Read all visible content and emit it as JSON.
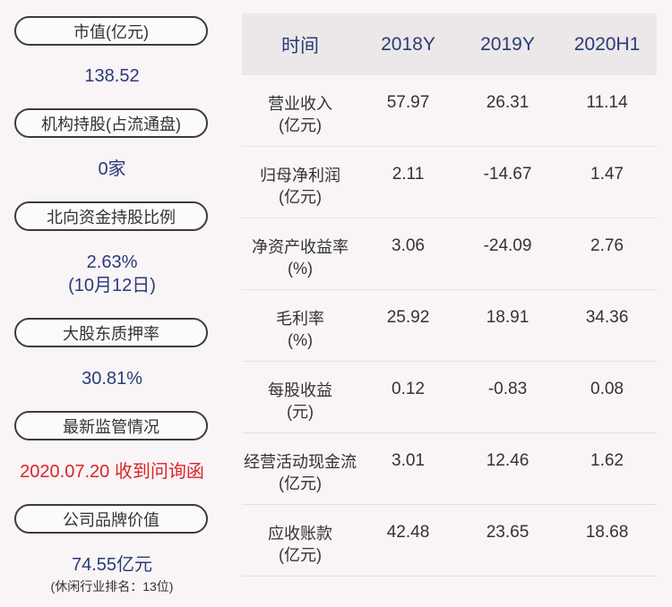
{
  "left": {
    "market_cap": {
      "label": "市值(亿元)",
      "value": "138.52"
    },
    "institution": {
      "label": "机构持股(占流通盘)",
      "value": "0家"
    },
    "northbound": {
      "label": "北向资金持股比例",
      "value": "2.63%",
      "date": "(10月12日)"
    },
    "pledge": {
      "label": "大股东质押率",
      "value": "30.81%"
    },
    "regulation": {
      "label": "最新监管情况",
      "value": "2020.07.20 收到问询函"
    },
    "brand": {
      "label": "公司品牌价值",
      "value": "74.55亿元",
      "rank": "(休闲行业排名：13位)"
    }
  },
  "table": {
    "headers": [
      "时间",
      "2018Y",
      "2019Y",
      "2020H1"
    ],
    "rows": [
      {
        "name": "营业收入",
        "unit": "(亿元)",
        "values": [
          "57.97",
          "26.31",
          "11.14"
        ]
      },
      {
        "name": "归母净利润",
        "unit": "(亿元)",
        "values": [
          "2.11",
          "-14.67",
          "1.47"
        ]
      },
      {
        "name": "净资产收益率",
        "unit": "(%)",
        "values": [
          "3.06",
          "-24.09",
          "2.76"
        ]
      },
      {
        "name": "毛利率",
        "unit": "(%)",
        "values": [
          "25.92",
          "18.91",
          "34.36"
        ]
      },
      {
        "name": "每股收益",
        "unit": "(元)",
        "values": [
          "0.12",
          "-0.83",
          "0.08"
        ]
      },
      {
        "name": "经营活动现金流",
        "unit": "(亿元)",
        "values": [
          "3.01",
          "12.46",
          "1.62"
        ]
      },
      {
        "name": "应收账款",
        "unit": "(亿元)",
        "values": [
          "42.48",
          "23.65",
          "18.68"
        ]
      }
    ]
  },
  "colors": {
    "accent": "#2a3b78",
    "alert": "#d7262b",
    "header_bg": "#ece7e9"
  }
}
